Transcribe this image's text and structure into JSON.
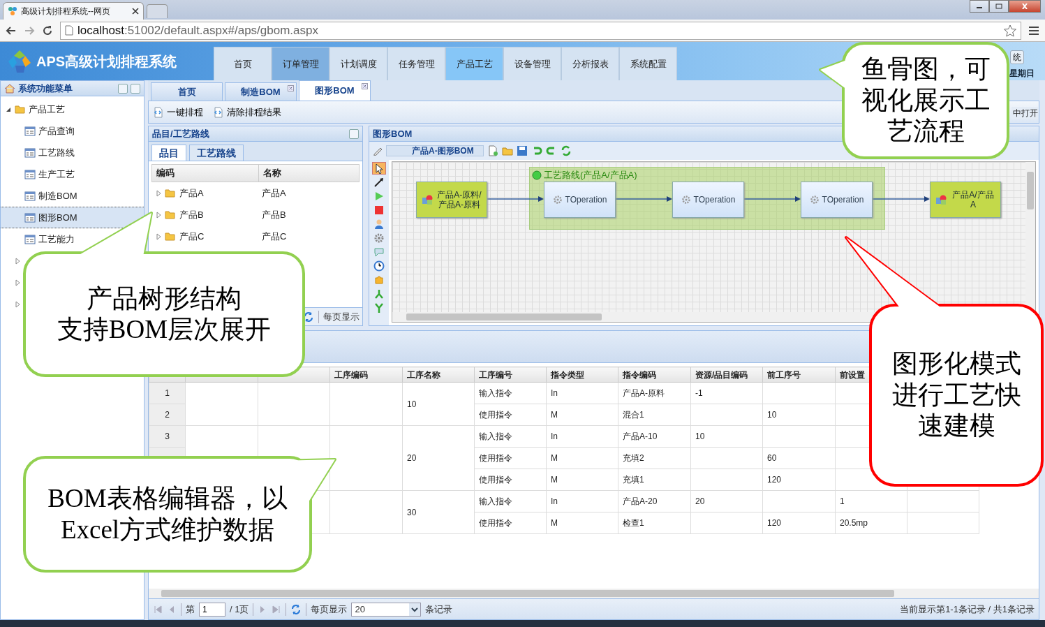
{
  "browser": {
    "tab_title": "高级计划排程系统--网页",
    "url_host": "localhost",
    "url_rest": ":51002/default.aspx#/aps/gbom.aspx"
  },
  "app": {
    "title": "APS高级计划排程系统",
    "nav": [
      {
        "label": "首页",
        "selected": false,
        "hovered": false
      },
      {
        "label": "订单管理",
        "selected": false,
        "hovered": true
      },
      {
        "label": "计划调度",
        "selected": false,
        "hovered": false
      },
      {
        "label": "任务管理",
        "selected": false,
        "hovered": false
      },
      {
        "label": "产品工艺",
        "selected": true,
        "hovered": false
      },
      {
        "label": "设备管理",
        "selected": false,
        "hovered": false
      },
      {
        "label": "分析报表",
        "selected": false,
        "hovered": false
      },
      {
        "label": "系统配置",
        "selected": false,
        "hovered": false
      }
    ],
    "header_button": "统",
    "header_date": "星期日"
  },
  "sidebar": {
    "title": "系统功能菜单",
    "tree": [
      {
        "label": "产品工艺",
        "expanded": true,
        "children": [
          {
            "label": "产品查询",
            "selected": false
          },
          {
            "label": "工艺路线",
            "selected": false
          },
          {
            "label": "生产工艺",
            "selected": false
          },
          {
            "label": "制造BOM",
            "selected": false
          },
          {
            "label": "图形BOM",
            "selected": true
          },
          {
            "label": "工艺能力",
            "selected": false
          }
        ]
      },
      {
        "expanded": false
      },
      {
        "expanded": false
      },
      {
        "expanded": false
      }
    ]
  },
  "tabs": [
    {
      "label": "首页",
      "selected": false,
      "closable": false
    },
    {
      "label": "制造BOM",
      "selected": false,
      "closable": true
    },
    {
      "label": "图形BOM",
      "selected": true,
      "closable": true
    }
  ],
  "toolbar": {
    "buttons": [
      "一键排程",
      "清除排程结果"
    ],
    "right_text": "中打开"
  },
  "item_panel": {
    "title": "品目/工艺路线",
    "tabs": [
      {
        "label": "品目",
        "selected": true
      },
      {
        "label": "工艺路线",
        "selected": false
      }
    ],
    "columns": [
      "编码",
      "名称"
    ],
    "rows": [
      {
        "code": "产品A",
        "name": "产品A",
        "expanded": false
      },
      {
        "code": "产品B",
        "name": "产品B",
        "expanded": false
      },
      {
        "code": "产品C",
        "name": "产品C",
        "expanded": false
      }
    ],
    "pager_text": "每页显示"
  },
  "graph_panel": {
    "title": "图形BOM",
    "document": "产品A-图形BOM",
    "palette": [
      {
        "selected": true
      },
      {
        "selected": false
      },
      {
        "selected": false
      },
      {
        "selected": false
      },
      {
        "selected": false
      },
      {
        "selected": false
      },
      {
        "selected": false
      },
      {
        "selected": false
      },
      {
        "selected": false
      },
      {
        "selected": false
      },
      {
        "selected": false
      }
    ],
    "group_label": "工艺路线(产品A/产品A)",
    "nodes": [
      {
        "kind": "material",
        "label": "产品A-原料/产品A-原料"
      },
      {
        "kind": "operation",
        "label": "TOperation"
      },
      {
        "kind": "operation",
        "label": "TOperation"
      },
      {
        "kind": "operation",
        "label": "TOperation"
      },
      {
        "kind": "material",
        "label": "产品A/产品A"
      }
    ]
  },
  "bom_table": {
    "columns": [
      {},
      {},
      {},
      {
        "label": "工序编码"
      },
      {
        "label": "工序名称"
      },
      {
        "label": "工序编号"
      },
      {
        "label": "指令类型"
      },
      {
        "label": "指令编码"
      },
      {
        "label": "资源/品目编码"
      },
      {
        "label": "前工序号"
      },
      {
        "label": "前设置"
      },
      {},
      {}
    ],
    "groups": [
      {
        "op_no": "10",
        "rows": [
          {
            "no": "1",
            "cmd_type": "输入指令",
            "cmd_code": "In",
            "resource": "产品A-原料",
            "prev_op": "-1"
          },
          {
            "no": "2",
            "cmd_type": "使用指令",
            "cmd_code": "M",
            "resource": "混合1",
            "setup": "10"
          }
        ]
      },
      {
        "op_no": "20",
        "rows": [
          {
            "no": "3",
            "cmd_type": "输入指令",
            "cmd_code": "In",
            "resource": "产品A-10",
            "prev_op": "10"
          },
          {
            "cmd_type": "使用指令",
            "cmd_code": "M",
            "resource": "充填2",
            "setup": "60"
          },
          {
            "cmd_type": "使用指令",
            "cmd_code": "M",
            "resource": "充填1",
            "setup": "120"
          }
        ]
      },
      {
        "op_no": "30",
        "rows": [
          {
            "cmd_type": "输入指令",
            "cmd_code": "In",
            "resource": "产品A-20",
            "prev_op": "20",
            "column_12": "1"
          },
          {
            "cmd_type": "使用指令",
            "cmd_code": "M",
            "resource": "检查1",
            "setup": "120",
            "column_12": "20.5mp"
          }
        ]
      }
    ]
  },
  "pager": {
    "page_label": "第",
    "page": "1",
    "pages": "/ 1页",
    "page_size_label": "每页显示",
    "page_size": "20",
    "records_label": "条记录",
    "summary": "当前显示第1-1条记录 / 共1条记录"
  },
  "callouts": [
    {
      "lines": [
        "鱼骨图，可",
        "视化展示工",
        "艺流程"
      ],
      "color": "#92d050"
    },
    {
      "lines": [
        "产品树形结构",
        "支持BOM层次展开"
      ],
      "color": "#92d050"
    },
    {
      "lines": [
        "BOM表格编辑器，以",
        "Excel方式维护数据"
      ],
      "color": "#92d050"
    },
    {
      "lines": [
        "图形化模式",
        "进行工艺快",
        "速建模"
      ],
      "color": "#ff0000"
    }
  ]
}
